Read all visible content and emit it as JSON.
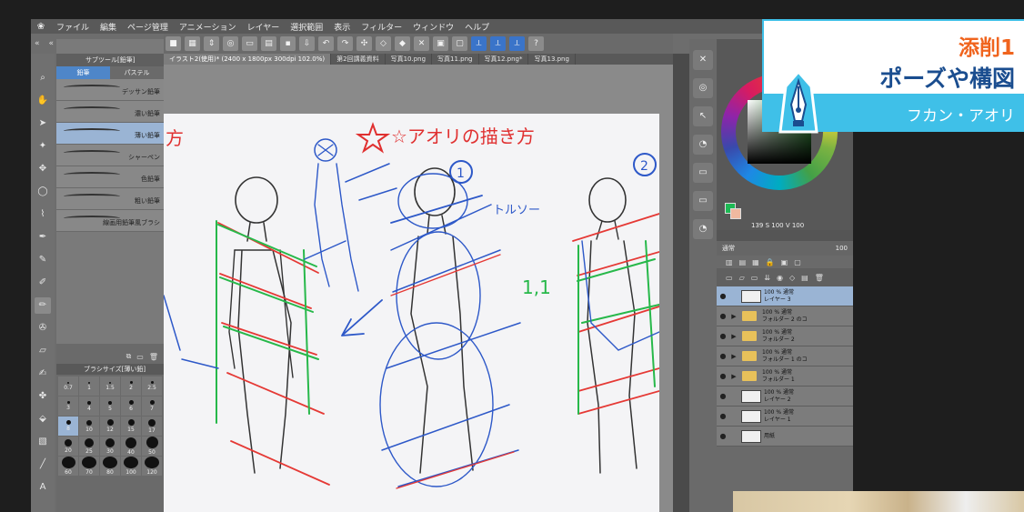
{
  "menu": {
    "items": [
      "ファイル",
      "編集",
      "ページ管理",
      "アニメーション",
      "レイヤー",
      "選択範囲",
      "表示",
      "フィルター",
      "ウィンドウ",
      "ヘルプ"
    ]
  },
  "tabs": [
    {
      "label": "イラスト2(使用)* (2400 x 1800px 300dpi 102.0%)",
      "active": true
    },
    {
      "label": "第2回講義資料",
      "active": false
    },
    {
      "label": "写真10.png",
      "active": false
    },
    {
      "label": "写真11.png",
      "active": false
    },
    {
      "label": "写真12.png*",
      "active": false
    },
    {
      "label": "写真13.png",
      "active": false
    }
  ],
  "subtool": {
    "title": "サブツール[鉛筆]",
    "categories": [
      "鉛筆",
      "パステル"
    ],
    "brushes": [
      {
        "label": "デッサン鉛筆",
        "selected": false
      },
      {
        "label": "濃い鉛筆",
        "selected": false
      },
      {
        "label": "薄い鉛筆",
        "selected": true
      },
      {
        "label": "シャーペン",
        "selected": false
      },
      {
        "label": "色鉛筆",
        "selected": false
      },
      {
        "label": "粗い鉛筆",
        "selected": false
      },
      {
        "label": "線画用鉛筆風ブラシ",
        "selected": false
      }
    ]
  },
  "brushsize": {
    "title": "ブラシサイズ[薄い鉛]",
    "sizes": [
      "0.7",
      "1",
      "1.5",
      "2",
      "2.5",
      "3",
      "4",
      "5",
      "6",
      "7",
      "8",
      "10",
      "12",
      "15",
      "17",
      "20",
      "25",
      "30",
      "40",
      "50",
      "60",
      "70",
      "80",
      "100",
      "120"
    ],
    "selected": "8"
  },
  "canvas": {
    "text_title": "☆アオリの描き方",
    "text_partial": "方",
    "text_torso": "トルソー",
    "label_1": "1",
    "label_2": "2",
    "label_11": "1,1"
  },
  "color": {
    "hsv": "139 S 100 V 100"
  },
  "layers": {
    "blend": "通常",
    "opacity": "100",
    "items": [
      {
        "kind": "raster",
        "line1": "100 % 通常",
        "line2": "レイヤー 3",
        "selected": true
      },
      {
        "kind": "folder",
        "line1": "100 % 通常",
        "line2": "フォルダー 2 のコ",
        "selected": false
      },
      {
        "kind": "folder",
        "line1": "100 % 通常",
        "line2": "フォルダー 2",
        "selected": false
      },
      {
        "kind": "folder",
        "line1": "100 % 通常",
        "line2": "フォルダー 1 のコ",
        "selected": false
      },
      {
        "kind": "folder",
        "line1": "100 % 通常",
        "line2": "フォルダー 1",
        "selected": false
      },
      {
        "kind": "raster",
        "line1": "100 % 通常",
        "line2": "レイヤー 2",
        "selected": false
      },
      {
        "kind": "raster",
        "line1": "100 % 通常",
        "line2": "レイヤー 1",
        "selected": false
      },
      {
        "kind": "paper",
        "line1": "",
        "line2": "用紙",
        "selected": false
      }
    ]
  },
  "banner": {
    "line1": "添削1",
    "line2": "ポーズや構図",
    "line3": "フカン・アオリ",
    "orange": "#f0641e",
    "navy": "#1a4d8f",
    "cyan": "#3fc0e8"
  }
}
